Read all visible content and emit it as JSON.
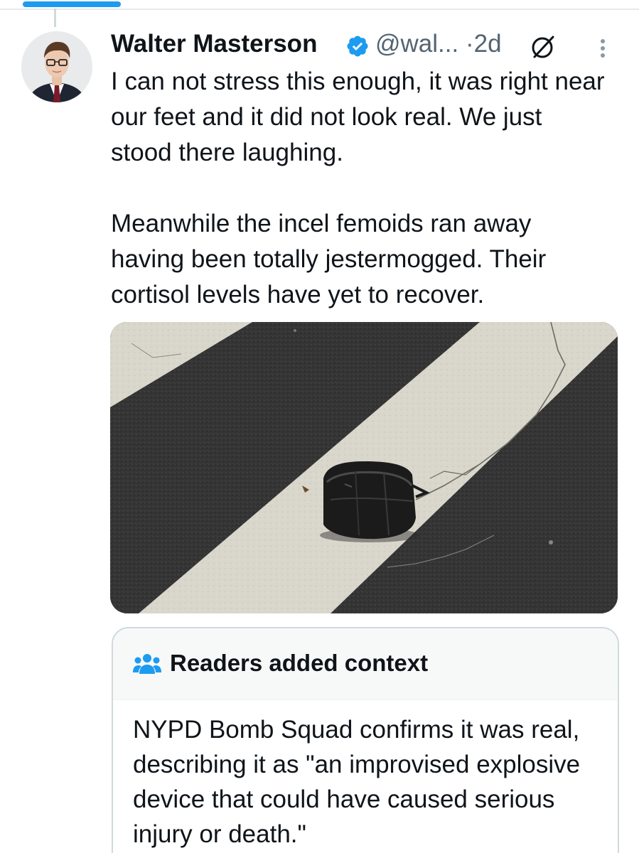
{
  "tweet": {
    "author_name": "Walter Masterson",
    "handle": "@wal...",
    "separator": "·",
    "time": "2d",
    "paragraphs": [
      "I can not stress this enough, it was right near our feet and it did not look real. We just stood there laughing.",
      "Meanwhile the incel femoids ran away having been totally jestermogged. Their cortisol levels have yet to recover."
    ]
  },
  "community_note": {
    "title": "Readers added context",
    "body": "NYPD Bomb Squad confirms it was real, describing it as \"an improvised explosive device that could have caused serious injury or death.\""
  },
  "icons": {
    "verified": "verified-badge-icon",
    "grok": "grok-icon",
    "more": "more-options-icon",
    "people": "people-icon"
  },
  "colors": {
    "accent": "#1d9bf0",
    "text": "#0f1419",
    "secondary_text": "#536471",
    "border": "#cfd9de",
    "note_header_bg": "#f7f9f9"
  }
}
